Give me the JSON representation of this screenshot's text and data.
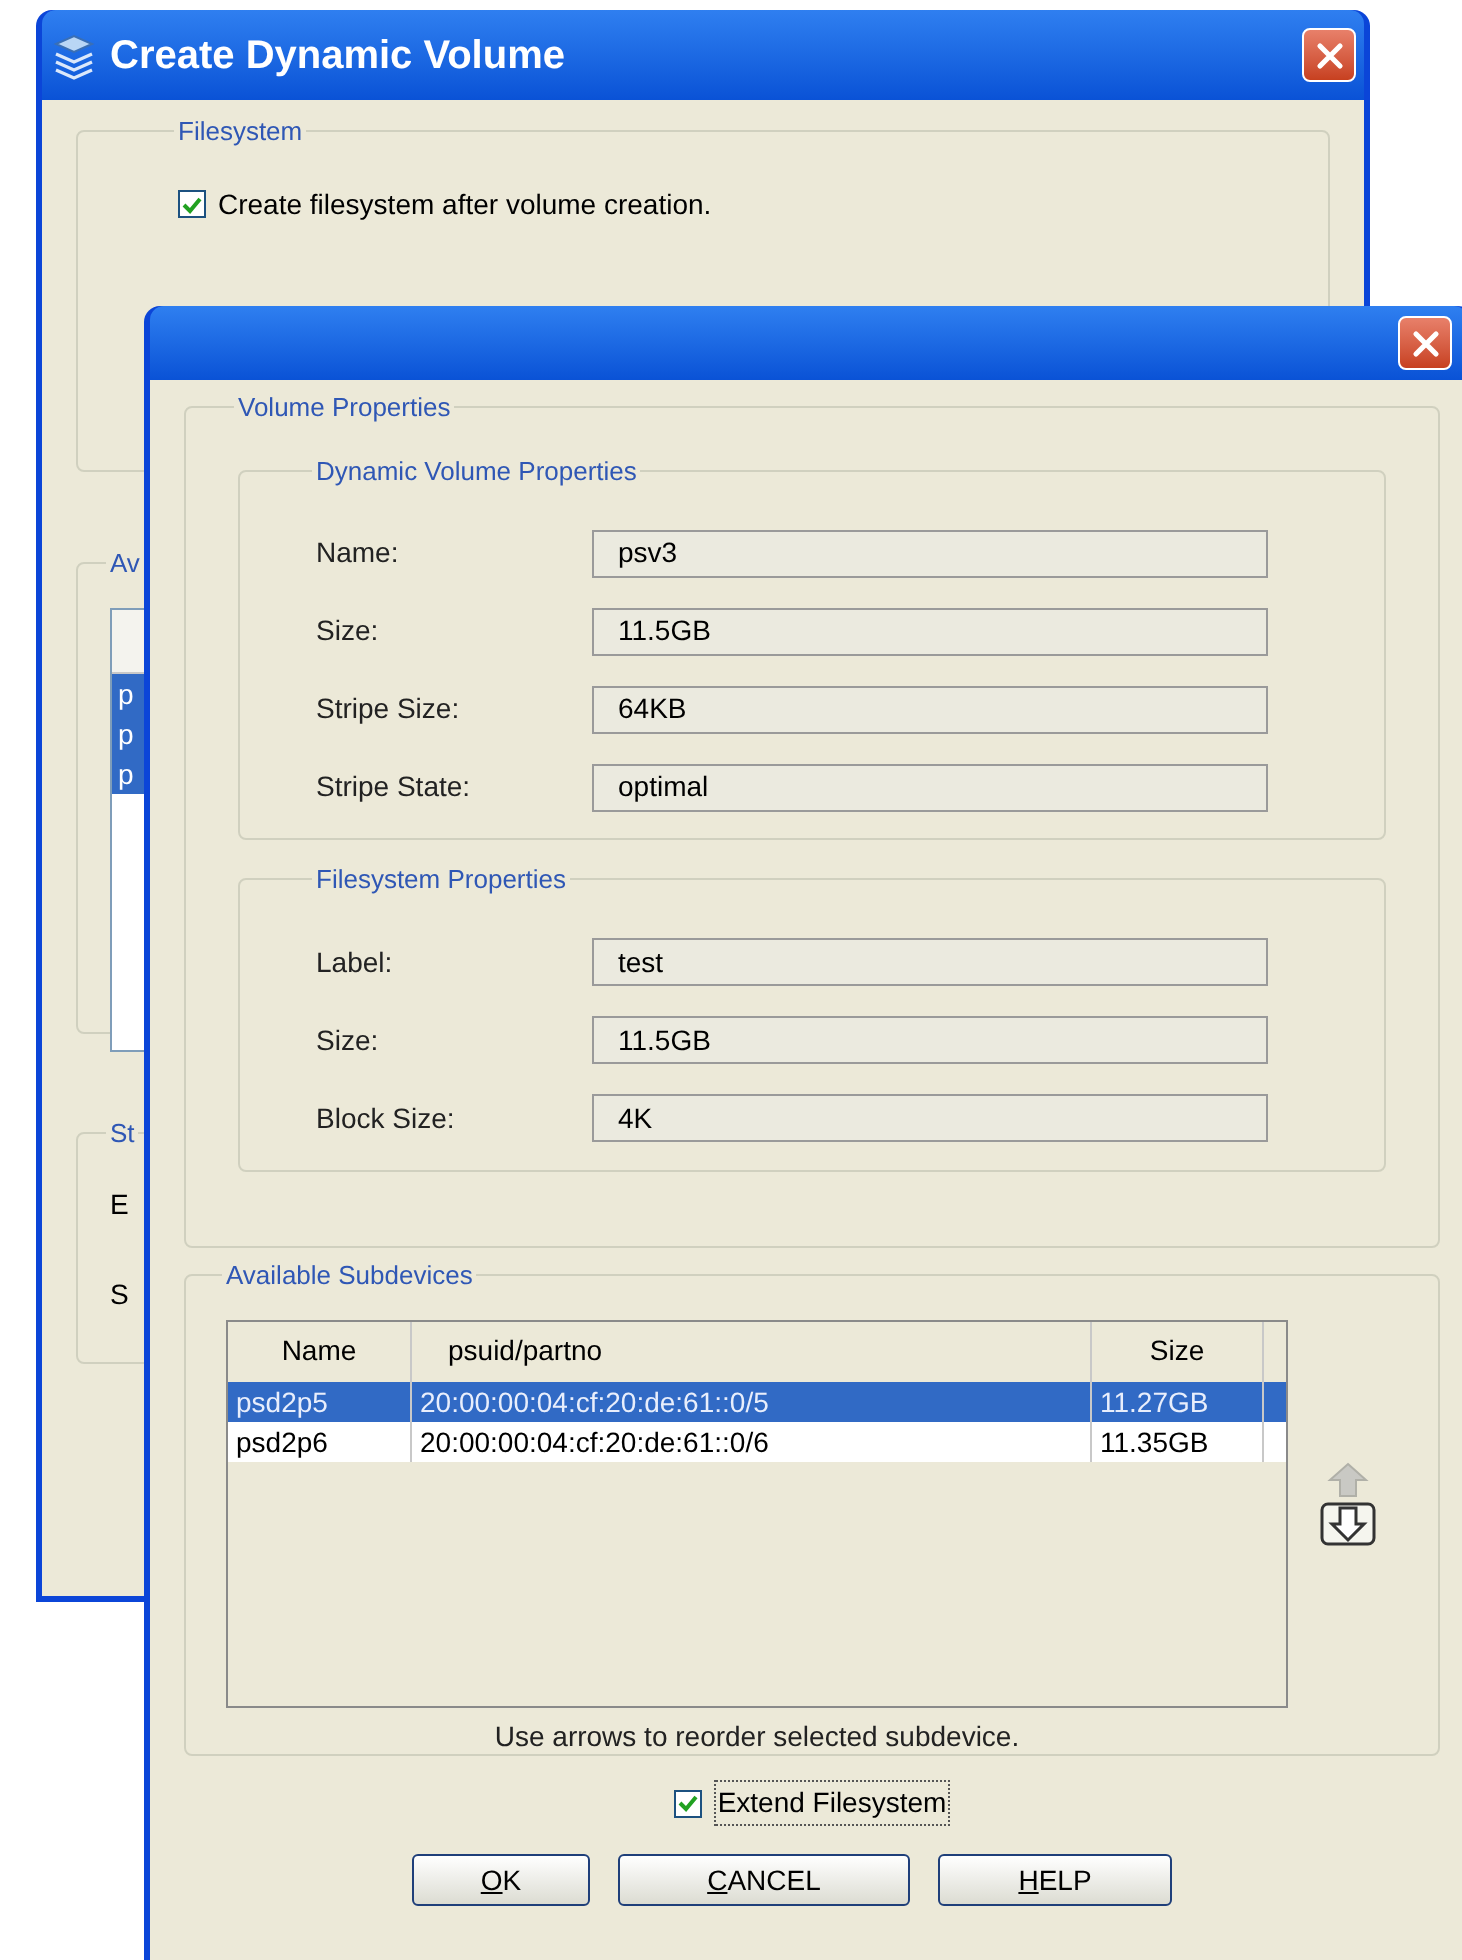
{
  "back_window": {
    "title": "Create Dynamic Volume",
    "filesystem_group": {
      "title": "Filesystem",
      "checkbox": {
        "label": "Create filesystem after volume creation.",
        "checked": true
      }
    },
    "group_2": {
      "title": "Av",
      "rows": [
        {
          "text": "p",
          "selected": true
        },
        {
          "text": "p",
          "selected": true
        },
        {
          "text": "p",
          "selected": true
        }
      ]
    },
    "group_3": {
      "title": "St",
      "labels": [
        "E",
        "S"
      ]
    }
  },
  "front_window": {
    "volume_properties": {
      "title": "Volume Properties",
      "groups": [
        {
          "title": "Dynamic Volume Properties",
          "fields": [
            {
              "label": "Name:",
              "value": "psv3"
            },
            {
              "label": "Size:",
              "value": "11.5GB"
            },
            {
              "label": "Stripe Size:",
              "value": "64KB"
            },
            {
              "label": "Stripe State:",
              "value": "optimal"
            }
          ]
        },
        {
          "title": "Filesystem Properties",
          "fields": [
            {
              "label": "Label:",
              "value": "test"
            },
            {
              "label": "Size:",
              "value": "11.5GB"
            },
            {
              "label": "Block Size:",
              "value": "4K"
            }
          ]
        }
      ]
    },
    "subdevices": {
      "title": "Available Subdevices",
      "columns": [
        "Name",
        "psuid/partno",
        "Size"
      ],
      "rows": [
        {
          "cells": [
            "psd2p5",
            "20:00:00:04:cf:20:de:61::0/5",
            "11.27GB"
          ],
          "selected": true
        },
        {
          "cells": [
            "psd2p6",
            "20:00:00:04:cf:20:de:61::0/6",
            "11.35GB"
          ],
          "selected": false
        }
      ],
      "hint": "Use arrows to reorder selected subdevice."
    },
    "extend_checkbox": {
      "label": "Extend Filesystem",
      "checked": true
    },
    "buttons": [
      {
        "label": "OK"
      },
      {
        "label": "CANCEL"
      },
      {
        "label": "HELP"
      }
    ]
  }
}
